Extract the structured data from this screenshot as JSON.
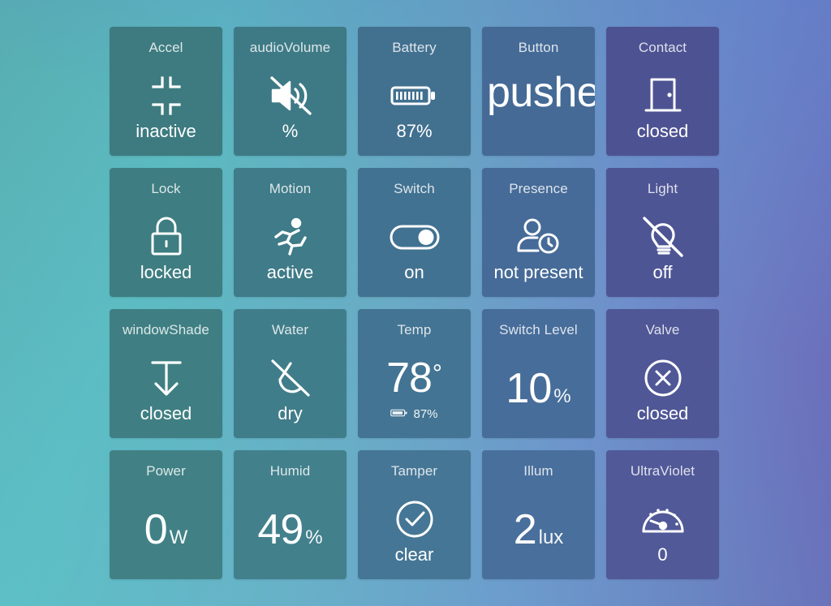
{
  "page": {
    "background_colors": {
      "top_left": "#57aeb1",
      "top_right": "#6a63b6",
      "bottom_left": "#62cad2",
      "bottom_right": "#7b8fdd"
    }
  },
  "tiles": [
    {
      "id": "accel",
      "title": "Accel",
      "icon": "compress-arrows-icon",
      "value": "inactive",
      "bg": "#3d7b80"
    },
    {
      "id": "audio-volume",
      "title": "audioVolume",
      "icon": "volume-mute-icon",
      "value": "%",
      "bg": "#3e7a86"
    },
    {
      "id": "battery",
      "title": "Battery",
      "icon": "battery-icon",
      "value": "87%",
      "bg": "#42708f"
    },
    {
      "id": "button",
      "title": "Button",
      "icon": "",
      "value": "pushed",
      "value_clipped": "pushe",
      "bg": "#456a96"
    },
    {
      "id": "contact",
      "title": "Contact",
      "icon": "door-closed-icon",
      "value": "closed",
      "bg": "#4d5392"
    },
    {
      "id": "lock",
      "title": "Lock",
      "icon": "lock-closed-icon",
      "value": "locked",
      "bg": "#3e7d81"
    },
    {
      "id": "motion",
      "title": "Motion",
      "icon": "running-person-icon",
      "value": "active",
      "bg": "#3f7b88"
    },
    {
      "id": "switch",
      "title": "Switch",
      "icon": "toggle-on-icon",
      "value": "on",
      "bg": "#427291"
    },
    {
      "id": "presence",
      "title": "Presence",
      "icon": "person-clock-icon",
      "value": "not present",
      "bg": "#466b98"
    },
    {
      "id": "light",
      "title": "Light",
      "icon": "lightbulb-off-icon",
      "value": "off",
      "bg": "#4e5594"
    },
    {
      "id": "window-shade",
      "title": "windowShade",
      "icon": "shade-down-arrow-icon",
      "value": "closed",
      "bg": "#3f7f83"
    },
    {
      "id": "water",
      "title": "Water",
      "icon": "water-drop-off-icon",
      "value": "dry",
      "bg": "#407d8a"
    },
    {
      "id": "temp",
      "title": "Temp",
      "icon": "",
      "number": "78",
      "unit": "°",
      "sub_icon": "battery-small-icon",
      "sub_text": "87%",
      "bg": "#437493"
    },
    {
      "id": "switch-level",
      "title": "Switch Level",
      "icon": "",
      "number": "10",
      "unit": "%",
      "bg": "#476d9a"
    },
    {
      "id": "valve",
      "title": "Valve",
      "icon": "circle-x-icon",
      "value": "closed",
      "bg": "#4f5796"
    },
    {
      "id": "power",
      "title": "Power",
      "icon": "",
      "number": "0",
      "unit": "W",
      "bg": "#418185"
    },
    {
      "id": "humid",
      "title": "Humid",
      "icon": "",
      "number": "49",
      "unit": "%",
      "bg": "#42808c"
    },
    {
      "id": "tamper",
      "title": "Tamper",
      "icon": "check-circle-icon",
      "value": "clear",
      "bg": "#457695"
    },
    {
      "id": "illum",
      "title": "Illum",
      "icon": "",
      "number": "2",
      "unit": "lux",
      "bg": "#496f9c"
    },
    {
      "id": "ultraviolet",
      "title": "UltraViolet",
      "icon": "gauge-icon",
      "value": "0",
      "bg": "#515998"
    }
  ]
}
